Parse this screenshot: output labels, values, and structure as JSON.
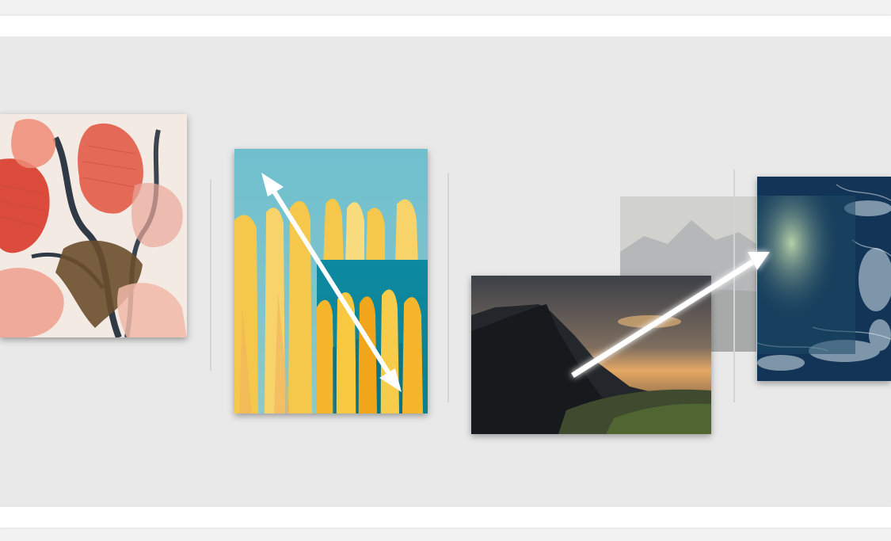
{
  "page": {
    "colors": {
      "stage": "#e8e9e8",
      "strip": "#ffffff",
      "divider": "#d3d5d4",
      "arrow": "#ffffff"
    }
  },
  "panels": [
    {
      "name": "floral-engraving-image",
      "palette": [
        "#f2e8df",
        "#e46a57",
        "#2f3a46",
        "#6a4e2c"
      ]
    },
    {
      "name": "yellow-teal-drip-painting",
      "palette": [
        "#6fbfcf",
        "#f5c84b",
        "#0c8aa2",
        "#f0a61d"
      ]
    },
    {
      "name": "mountain-sunset-photo",
      "palette": [
        "#1d2126",
        "#e5a864",
        "#4a5a3a"
      ]
    },
    {
      "name": "ocean-waves-photo",
      "palette": [
        "#0f2b4a",
        "#d7e6ef",
        "#2c5780"
      ]
    }
  ],
  "arrows": [
    {
      "name": "double-headed-diagonal-arrow",
      "heads": "both"
    },
    {
      "name": "crossfade-arrow",
      "heads": "end"
    }
  ]
}
